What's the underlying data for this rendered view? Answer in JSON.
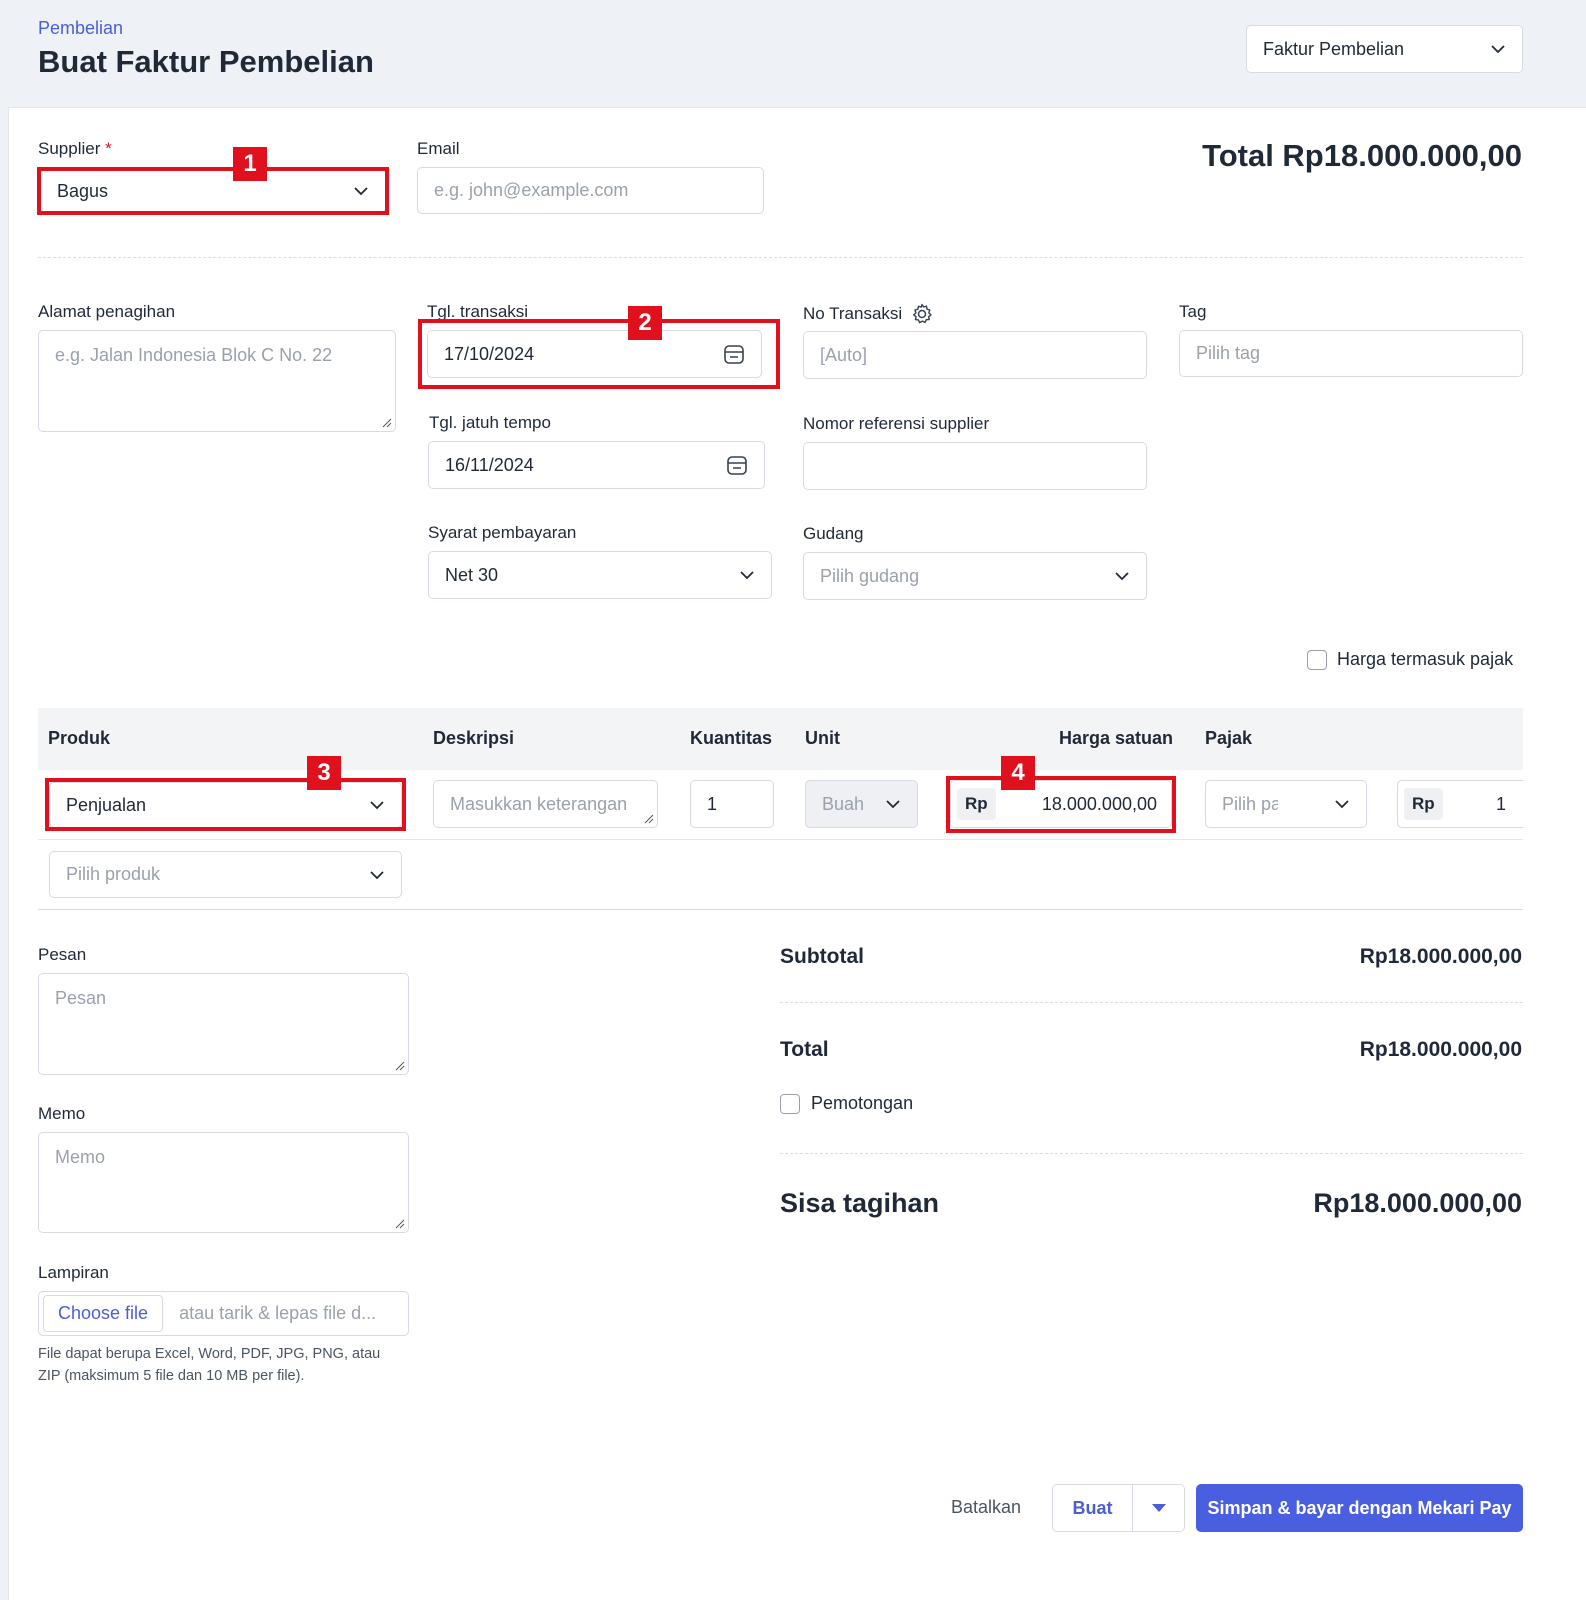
{
  "header": {
    "breadcrumb": "Pembelian",
    "title": "Buat Faktur Pembelian",
    "doc_type_select": "Faktur Pembelian"
  },
  "form": {
    "supplier_label": "Supplier",
    "required_mark": "*",
    "supplier_value": "Bagus",
    "email_label": "Email",
    "email_placeholder": "e.g. john@example.com",
    "total_label": "Total Rp18.000.000,00",
    "billing_address_label": "Alamat penagihan",
    "billing_address_placeholder": "e.g. Jalan Indonesia Blok C No. 22",
    "transaction_date_label": "Tgl. transaksi",
    "transaction_date_value": "17/10/2024",
    "due_date_label": "Tgl. jatuh tempo",
    "due_date_value": "16/11/2024",
    "payment_terms_label": "Syarat pembayaran",
    "payment_terms_value": "Net 30",
    "transaction_no_label": "No Transaksi",
    "transaction_no_placeholder": "[Auto]",
    "supplier_ref_label": "Nomor referensi supplier",
    "supplier_ref_value": "",
    "warehouse_label": "Gudang",
    "warehouse_placeholder": "Pilih gudang",
    "tag_label": "Tag",
    "tag_placeholder": "Pilih tag",
    "price_includes_tax_label": "Harga termasuk pajak"
  },
  "table": {
    "headers": [
      "Produk",
      "Deskripsi",
      "Kuantitas",
      "Unit",
      "Harga satuan",
      "Pajak"
    ],
    "row": {
      "product": "Penjualan",
      "description_placeholder": "Masukkan keterangan",
      "quantity": "1",
      "unit": "Buah",
      "currency": "Rp",
      "unit_price": "18.000.000,00",
      "tax_placeholder": "Pilih pajak",
      "amount_currency": "Rp",
      "amount_clipped": "1"
    },
    "add_product_placeholder": "Pilih produk"
  },
  "bottom": {
    "message_label": "Pesan",
    "message_placeholder": "Pesan",
    "memo_label": "Memo",
    "memo_placeholder": "Memo",
    "attachment_label": "Lampiran",
    "choose_file": "Choose file",
    "drag_drop": "atau tarik & lepas file d...",
    "attachment_help": "File dapat berupa Excel, Word, PDF, JPG, PNG, atau ZIP (maksimum 5 file dan 10 MB per file).",
    "subtotal_label": "Subtotal",
    "subtotal_value": "Rp18.000.000,00",
    "total_label": "Total",
    "total_value": "Rp18.000.000,00",
    "deduction_label": "Pemotongan",
    "balance_label": "Sisa tagihan",
    "balance_value": "Rp18.000.000,00"
  },
  "actions": {
    "cancel": "Batalkan",
    "create": "Buat",
    "save_pay": "Simpan & bayar dengan Mekari Pay"
  },
  "annotations": [
    "1",
    "2",
    "3",
    "4"
  ],
  "colors": {
    "accent": "#4a5fd6",
    "annotation": "#e0101d",
    "primary_button": "#4a5fe0"
  }
}
